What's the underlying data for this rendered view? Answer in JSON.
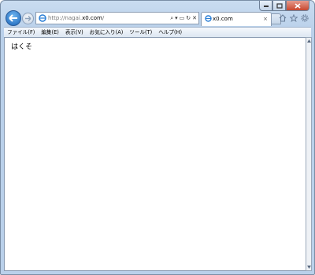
{
  "window": {
    "caption": {
      "minimize": "minimize",
      "maximize": "maximize",
      "close": "close"
    }
  },
  "navigation": {
    "address": {
      "prefix": "http://nagai.",
      "domain": "x0.com",
      "suffix": "/"
    },
    "address_tools": {
      "search": "⌕",
      "dropdown": "▾",
      "compat": "▭",
      "refresh": "↻",
      "stop": "✕"
    },
    "tab": {
      "title": "x0.com",
      "close": "×"
    }
  },
  "menu": {
    "items": [
      "ファイル(F)",
      "編集(E)",
      "表示(V)",
      "お気に入り(A)",
      "ツール(T)",
      "ヘルプ(H)"
    ]
  },
  "content": {
    "text": "はくそ"
  },
  "colors": {
    "frame": "#b9d0ea",
    "accent": "#1a63b8",
    "close": "#c8472f"
  }
}
